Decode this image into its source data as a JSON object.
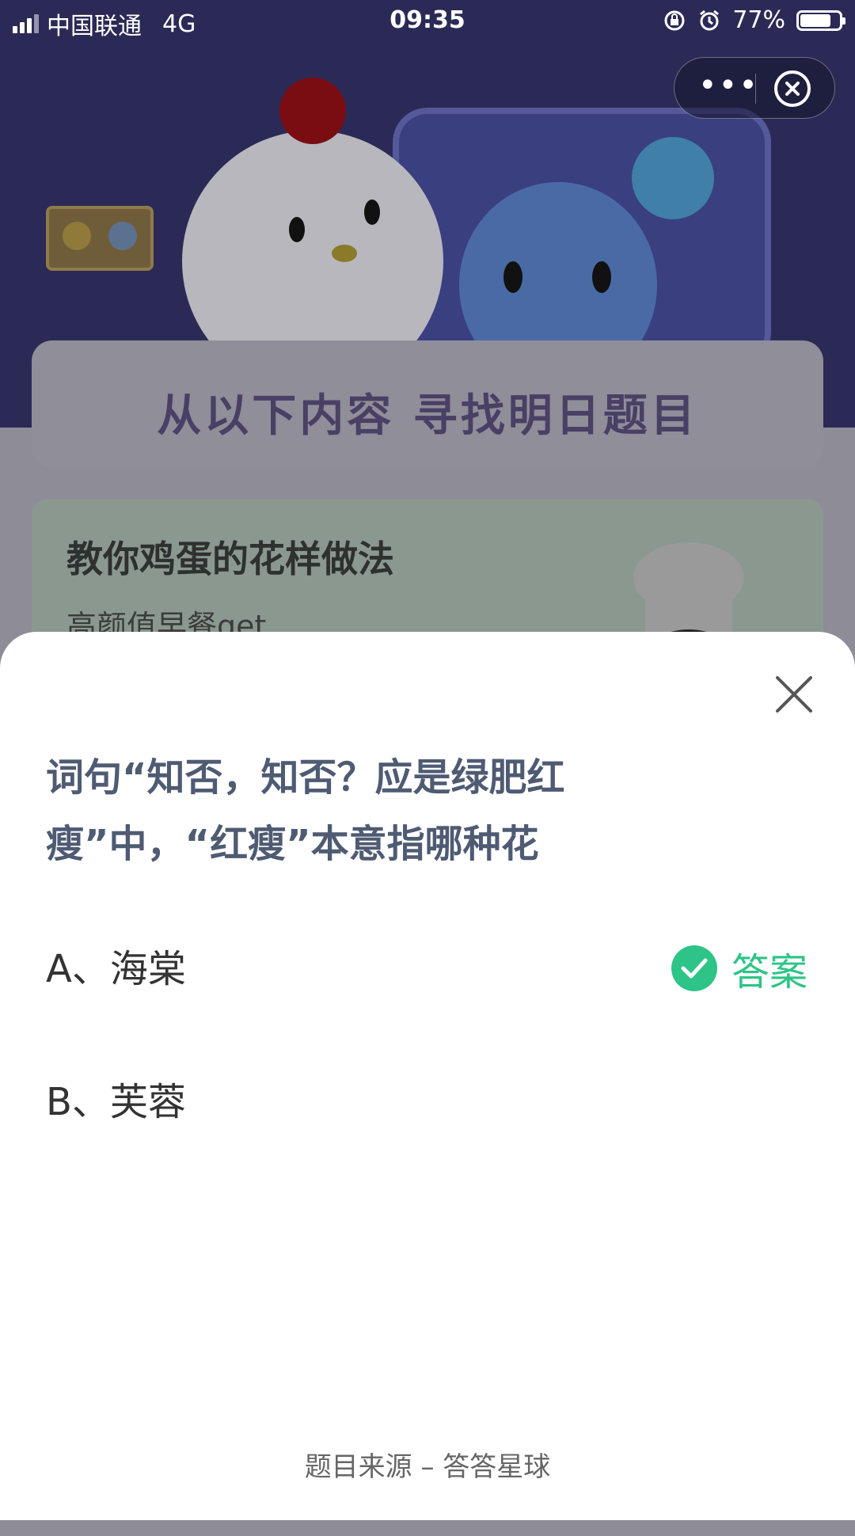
{
  "status_bar": {
    "carrier": "中国联通",
    "network": "4G",
    "time": "09:35",
    "battery": "77%"
  },
  "banner": {
    "heading": "从以下内容 寻找明日题目",
    "card_title": "教你鸡蛋的花样做法",
    "card_subtitle": "高颜值早餐get"
  },
  "quiz": {
    "question": "词句“知否，知否？应是绿肥红瘦”中，“红瘦”本意指哪种花",
    "options": [
      {
        "label": "A、海棠",
        "is_answer": true
      },
      {
        "label": "B、芙蓉",
        "is_answer": false
      }
    ],
    "answer_label": "答案",
    "source": "题目来源 – 答答星球"
  },
  "colors": {
    "answer_green": "#2ec487",
    "question_text": "#4f5b73",
    "banner_bg": "#2b2a56"
  },
  "icons": [
    "signal-icon",
    "orientation-lock-icon",
    "alarm-icon",
    "battery-icon",
    "more-icon",
    "close-circle-icon",
    "close-icon",
    "check-icon"
  ]
}
